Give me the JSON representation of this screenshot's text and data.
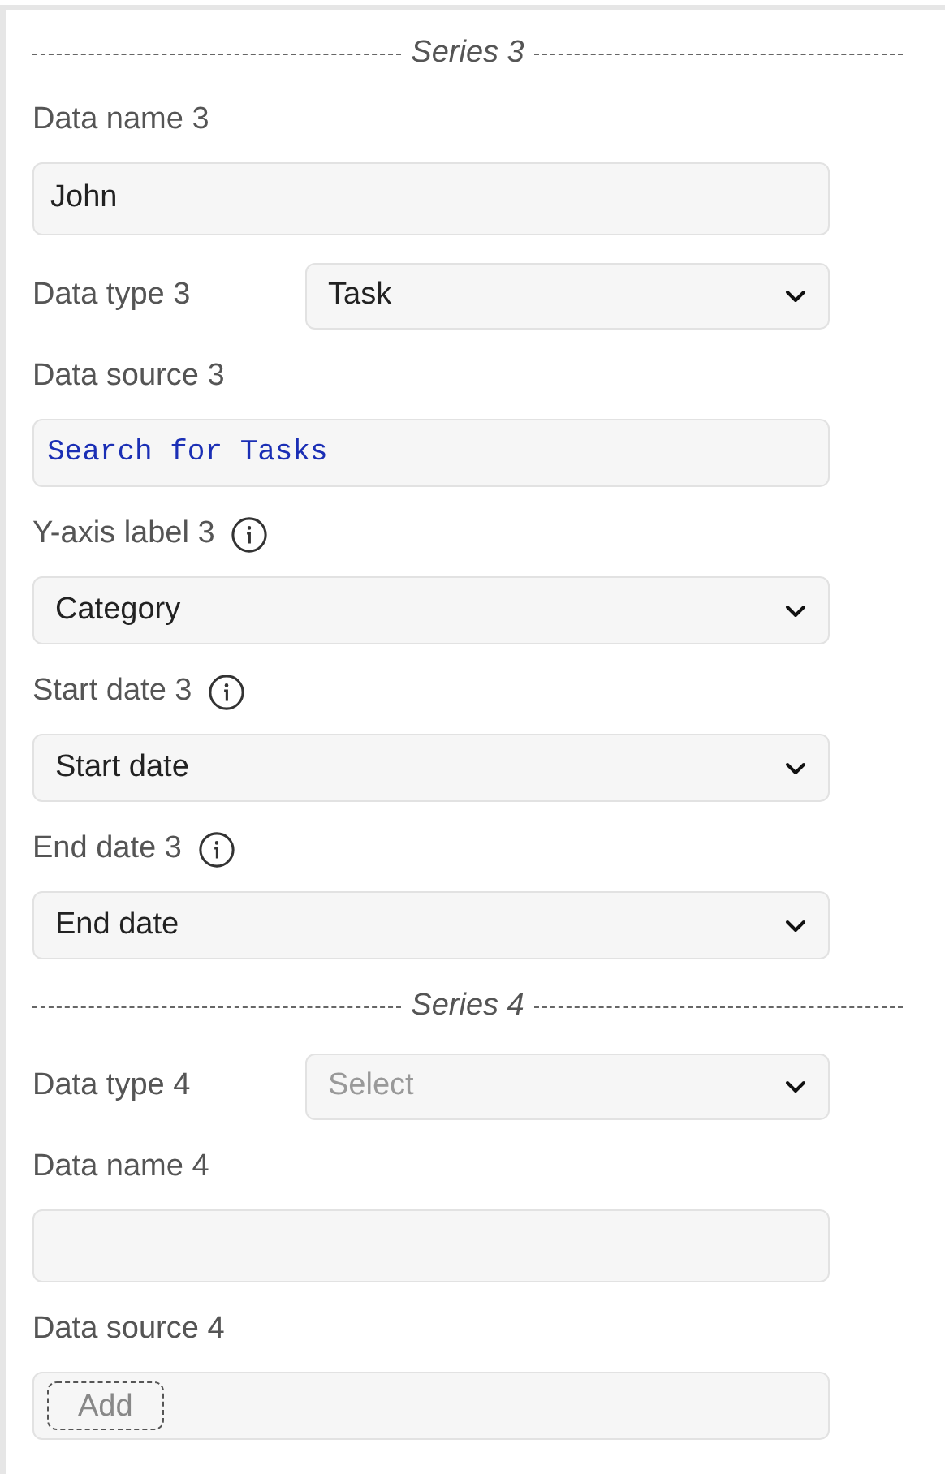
{
  "items": [
    {
      "kind": "separator",
      "title": "Series 3"
    },
    {
      "kind": "text",
      "label": "Data name 3",
      "value": "John"
    },
    {
      "kind": "inline_select",
      "label": "Data type 3",
      "value": "Task"
    },
    {
      "kind": "source",
      "label": "Data source 3",
      "value": "Search for Tasks"
    },
    {
      "kind": "select",
      "label": "Y-axis label 3",
      "info": true,
      "value": "Category"
    },
    {
      "kind": "select",
      "label": "Start date 3",
      "info": true,
      "value": "Start date"
    },
    {
      "kind": "select",
      "label": "End date 3",
      "info": true,
      "value": "End date"
    },
    {
      "kind": "separator",
      "title": "Series 4"
    },
    {
      "kind": "inline_select",
      "label": "Data type 4",
      "placeholder": "Select"
    },
    {
      "kind": "text",
      "label": "Data name 4"
    },
    {
      "kind": "source",
      "label": "Data source 4",
      "button": "Add"
    }
  ]
}
